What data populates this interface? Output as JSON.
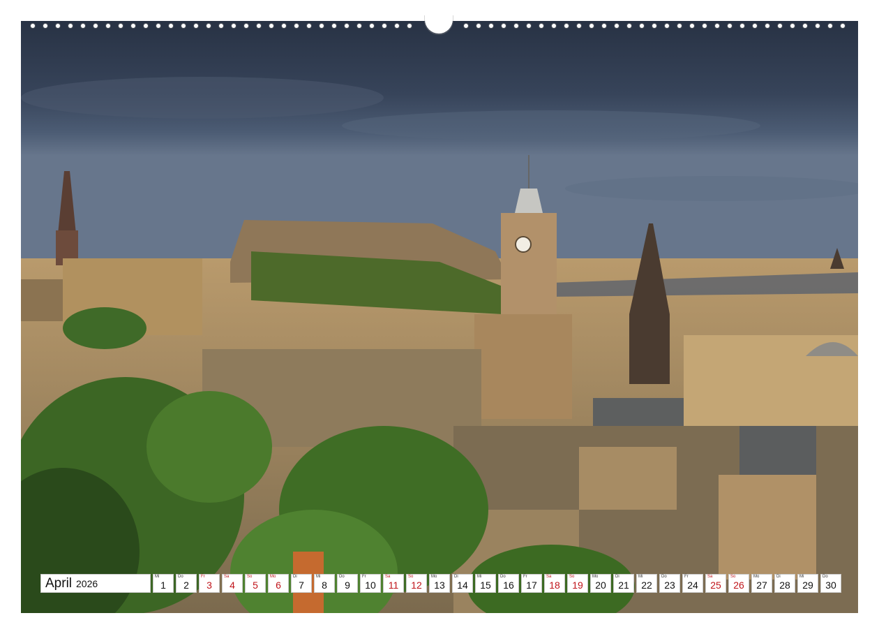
{
  "calendar": {
    "month": "April",
    "year": "2026",
    "days": [
      {
        "wd": "Mi",
        "num": "1",
        "red": false
      },
      {
        "wd": "Do",
        "num": "2",
        "red": false
      },
      {
        "wd": "Fr",
        "num": "3",
        "red": true
      },
      {
        "wd": "Sa",
        "num": "4",
        "red": true
      },
      {
        "wd": "So",
        "num": "5",
        "red": true
      },
      {
        "wd": "Mo",
        "num": "6",
        "red": true
      },
      {
        "wd": "Di",
        "num": "7",
        "red": false
      },
      {
        "wd": "Mi",
        "num": "8",
        "red": false
      },
      {
        "wd": "Do",
        "num": "9",
        "red": false
      },
      {
        "wd": "Fr",
        "num": "10",
        "red": false
      },
      {
        "wd": "Sa",
        "num": "11",
        "red": true
      },
      {
        "wd": "So",
        "num": "12",
        "red": true
      },
      {
        "wd": "Mo",
        "num": "13",
        "red": false
      },
      {
        "wd": "Di",
        "num": "14",
        "red": false
      },
      {
        "wd": "Mi",
        "num": "15",
        "red": false
      },
      {
        "wd": "Do",
        "num": "16",
        "red": false
      },
      {
        "wd": "Fr",
        "num": "17",
        "red": false
      },
      {
        "wd": "Sa",
        "num": "18",
        "red": true
      },
      {
        "wd": "So",
        "num": "19",
        "red": true
      },
      {
        "wd": "Mo",
        "num": "20",
        "red": false
      },
      {
        "wd": "Di",
        "num": "21",
        "red": false
      },
      {
        "wd": "Mi",
        "num": "22",
        "red": false
      },
      {
        "wd": "Do",
        "num": "23",
        "red": false
      },
      {
        "wd": "Fr",
        "num": "24",
        "red": false
      },
      {
        "wd": "Sa",
        "num": "25",
        "red": true
      },
      {
        "wd": "So",
        "num": "26",
        "red": true
      },
      {
        "wd": "Mo",
        "num": "27",
        "red": false
      },
      {
        "wd": "Di",
        "num": "28",
        "red": false
      },
      {
        "wd": "Mi",
        "num": "29",
        "red": false
      },
      {
        "wd": "Do",
        "num": "30",
        "red": false
      }
    ]
  },
  "colors": {
    "sky_dark": "#2a3445",
    "sky_light": "#6b7a90",
    "stone_warm": "#c9a774",
    "stone_shadow": "#6e5c44",
    "tree_green": "#3f6a25",
    "tree_dark": "#23401a",
    "holiday_red": "#c0141a"
  }
}
